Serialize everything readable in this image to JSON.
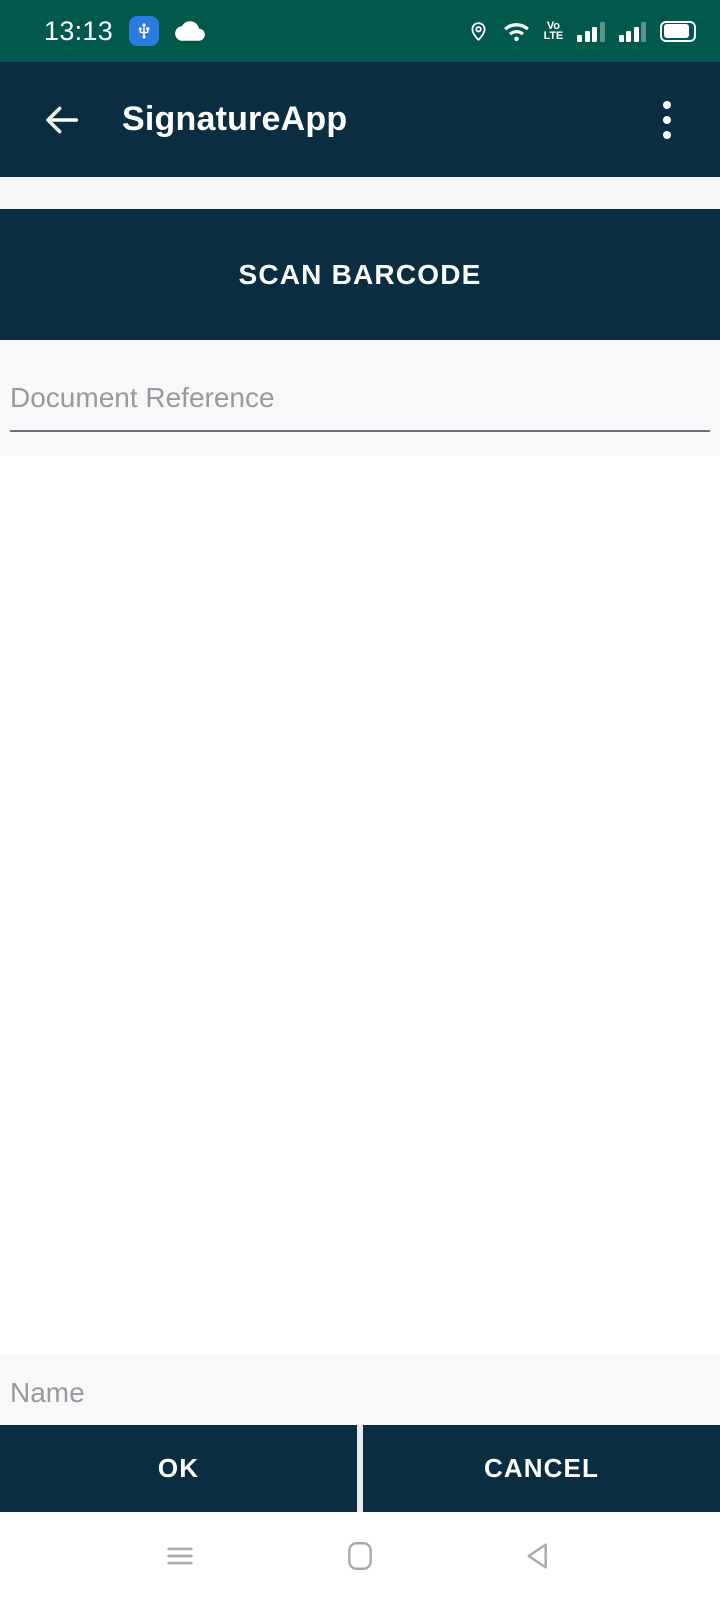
{
  "status_bar": {
    "time": "13:13",
    "background_color": "#00594b",
    "icons": [
      {
        "name": "usb-icon",
        "label": "USB"
      },
      {
        "name": "cloud-icon",
        "label": "Cloud sync"
      },
      {
        "name": "location-pin-icon",
        "label": "Location"
      },
      {
        "name": "wifi-icon",
        "label": "Wi-Fi"
      },
      {
        "name": "volte-icon",
        "label": "VoLTE"
      },
      {
        "name": "signal-bars-sim1-icon",
        "label": "Signal SIM 1"
      },
      {
        "name": "signal-bars-sim2-icon",
        "label": "Signal SIM 2"
      },
      {
        "name": "battery-icon",
        "label": "Battery"
      }
    ],
    "volte_line1": "Vo",
    "volte_line2": "LTE"
  },
  "app_bar": {
    "title": "SignatureApp",
    "back_icon": "arrow-left-icon",
    "overflow_icon": "more-vertical-icon",
    "background_color": "#0a2d42",
    "text_color": "#ffffff"
  },
  "main": {
    "scan_button_label": "SCAN BARCODE",
    "document_reference": {
      "label": "Document Reference",
      "placeholder": "Document Reference",
      "value": ""
    },
    "signature_area": {
      "name": "signature-canvas",
      "background_color": "#ffffff"
    }
  },
  "bottom": {
    "name_field": {
      "label": "Name",
      "placeholder": "Name",
      "value": ""
    },
    "ok_label": "OK",
    "cancel_label": "CANCEL"
  },
  "nav_bar": {
    "recents_icon": "menu-recents-icon",
    "home_icon": "home-square-icon",
    "back_icon": "back-triangle-icon"
  },
  "theme": {
    "accent": "#0a2d42",
    "status_green": "#00594b",
    "field_bg": "#f8f8fa",
    "underline": "#6e7075",
    "placeholder": "#9a9a9e"
  }
}
